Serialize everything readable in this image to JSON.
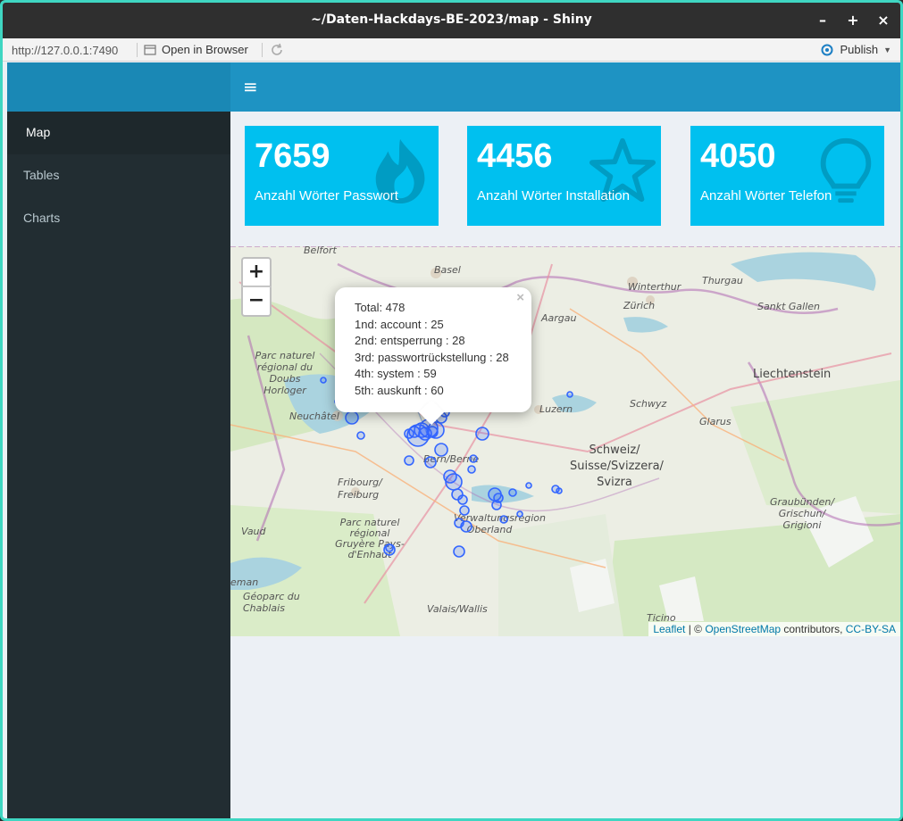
{
  "window": {
    "title": "~/Daten-Hackdays-BE-2023/map - Shiny",
    "minimize": "–",
    "maximize": "+",
    "close": "×"
  },
  "toolbar": {
    "url": "http://127.0.0.1:7490",
    "open_in_browser": "Open in Browser",
    "publish": "Publish"
  },
  "sidebar": {
    "items": [
      {
        "label": "Map",
        "active": true
      },
      {
        "label": "Tables",
        "active": false
      },
      {
        "label": "Charts",
        "active": false
      }
    ]
  },
  "header": {
    "menu_icon": "≡"
  },
  "valueboxes": [
    {
      "value": "7659",
      "subtitle": "Anzahl Wörter Passwort",
      "icon": "fire-icon",
      "color": "#00c0ef"
    },
    {
      "value": "4456",
      "subtitle": "Anzahl Wörter Installation",
      "icon": "star-icon",
      "color": "#00c0ef"
    },
    {
      "value": "4050",
      "subtitle": "Anzahl Wörter Telefon",
      "icon": "lightbulb-icon",
      "color": "#00c0ef"
    }
  ],
  "map": {
    "zoom_in": "+",
    "zoom_out": "−",
    "popup": {
      "close": "×",
      "lines": [
        "Total: 478",
        "1nd: account : 25",
        "2nd: entsperrung : 28",
        "3rd: passwortrückstellung : 28",
        "4th: system : 59",
        "5th: auskunft : 60"
      ]
    },
    "labels": {
      "belfort": "Belfort",
      "basel": "Basel",
      "winterthur": "Winterthur",
      "zurich": "Zürich",
      "thurgau": "Thurgau",
      "sankt_gallen": "Sankt Gallen",
      "aargau": "Aargau",
      "liechtenstein": "Liechtenstein",
      "schwyz": "Schwyz",
      "luzern": "Luzern",
      "glarus": "Glarus",
      "neuchatel": "Neuchâtel",
      "doubs": "Parc naturel régional du Doubs Horloger",
      "bern": "Bern/Berne",
      "schweiz": "Schweiz/ Suisse/Svizzera/ Svizra",
      "fribourg": "Fribourg/ Freiburg",
      "graubunden": "Graubünden/ Grischun/ Grigioni",
      "oberland": "Verwaltungsregion Oberland",
      "gruyere": "Parc naturel régional Gruyère Pays-d'Enhaut",
      "vaud": "Vaud",
      "geoparc": "Géoparc du Chablais",
      "valais": "Valais/Wallis",
      "ticino": "Ticino",
      "leman": "eman"
    },
    "attribution": {
      "leaflet": "Leaflet",
      "sep": " | © ",
      "osm": "OpenStreetMap",
      "contributors": " contributors, ",
      "license": "CC-BY-SA"
    },
    "marker_color": "#3366ff"
  }
}
